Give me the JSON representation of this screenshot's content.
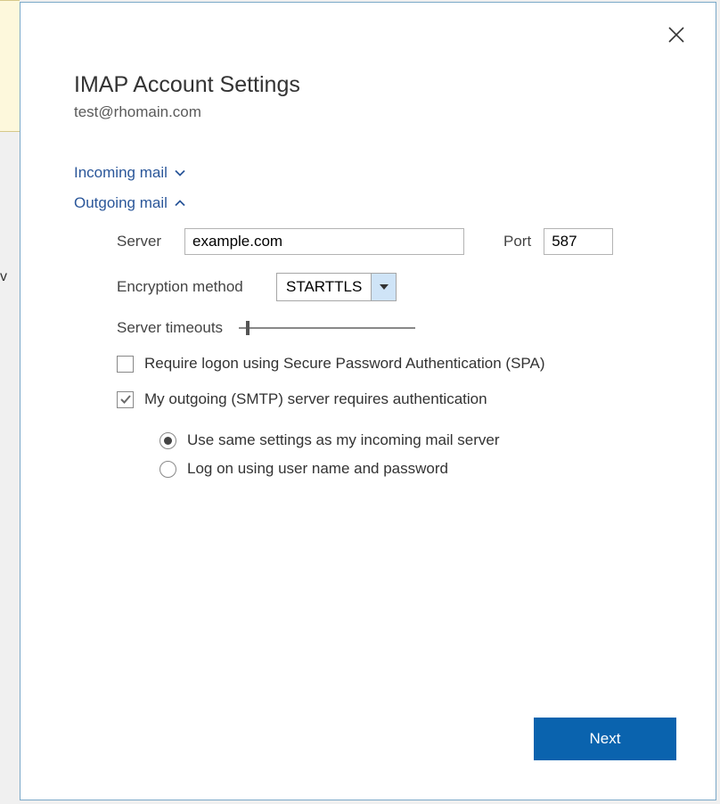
{
  "dialog": {
    "title": "IMAP Account Settings",
    "email": "test@rhomain.com"
  },
  "sections": {
    "incoming": {
      "label": "Incoming mail",
      "expanded": false
    },
    "outgoing": {
      "label": "Outgoing mail",
      "expanded": true
    }
  },
  "outgoing": {
    "server_label": "Server",
    "server_value": "example.com",
    "port_label": "Port",
    "port_value": "587",
    "encryption_label": "Encryption method",
    "encryption_value": "STARTTLS",
    "timeout_label": "Server timeouts",
    "spa_label": "Require logon using Secure Password Authentication (SPA)",
    "spa_checked": false,
    "auth_label": "My outgoing (SMTP) server requires authentication",
    "auth_checked": true,
    "radio_same_label": "Use same settings as my incoming mail server",
    "radio_logon_label": "Log on using user name and password",
    "radio_selected": "same"
  },
  "buttons": {
    "next": "Next"
  }
}
